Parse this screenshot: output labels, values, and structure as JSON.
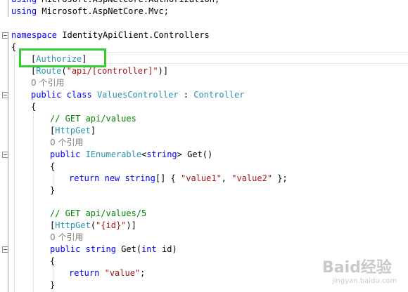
{
  "code": {
    "using_lines": [
      [
        {
          "c": "kw",
          "t": "using"
        },
        {
          "c": "",
          "t": " Microsoft.AspNetCore.Authorization;"
        }
      ],
      [
        {
          "c": "kw",
          "t": "using"
        },
        {
          "c": "",
          "t": " Microsoft.AspNetCore.Mvc;"
        }
      ]
    ],
    "lines": [
      [
        {
          "c": "kw",
          "t": "namespace"
        },
        {
          "c": "",
          "t": " IdentityApiClient.Controllers"
        }
      ],
      [
        {
          "c": "",
          "t": "{"
        }
      ],
      [
        {
          "c": "",
          "t": "["
        },
        {
          "c": "ty",
          "t": "Authorize"
        },
        {
          "c": "",
          "t": "]"
        }
      ],
      [
        {
          "c": "",
          "t": "["
        },
        {
          "c": "ty",
          "t": "Route"
        },
        {
          "c": "",
          "t": "("
        },
        {
          "c": "st",
          "t": "\"api/[controller]\""
        },
        {
          "c": "",
          "t": ")]"
        }
      ],
      [
        {
          "c": "ref",
          "t": "0 个引用"
        }
      ],
      [
        {
          "c": "kw",
          "t": "public"
        },
        {
          "c": "",
          "t": " "
        },
        {
          "c": "kw",
          "t": "class"
        },
        {
          "c": "",
          "t": " "
        },
        {
          "c": "ty",
          "t": "ValuesController"
        },
        {
          "c": "",
          "t": " : "
        },
        {
          "c": "ty",
          "t": "Controller"
        }
      ],
      [
        {
          "c": "",
          "t": "{"
        }
      ],
      [
        {
          "c": "cm",
          "t": "// GET api/values"
        }
      ],
      [
        {
          "c": "",
          "t": "["
        },
        {
          "c": "ty",
          "t": "HttpGet"
        },
        {
          "c": "",
          "t": "]"
        }
      ],
      [
        {
          "c": "ref",
          "t": "0 个引用"
        }
      ],
      [
        {
          "c": "kw",
          "t": "public"
        },
        {
          "c": "",
          "t": " "
        },
        {
          "c": "ty",
          "t": "IEnumerable"
        },
        {
          "c": "",
          "t": "<"
        },
        {
          "c": "kw",
          "t": "string"
        },
        {
          "c": "",
          "t": "> Get()"
        }
      ],
      [
        {
          "c": "",
          "t": "{"
        }
      ],
      [
        {
          "c": "kw",
          "t": "return"
        },
        {
          "c": "",
          "t": " "
        },
        {
          "c": "kw",
          "t": "new"
        },
        {
          "c": "",
          "t": " "
        },
        {
          "c": "kw",
          "t": "string"
        },
        {
          "c": "",
          "t": "[] { "
        },
        {
          "c": "st",
          "t": "\"value1\""
        },
        {
          "c": "",
          "t": ", "
        },
        {
          "c": "st",
          "t": "\"value2\""
        },
        {
          "c": "",
          "t": " };"
        }
      ],
      [
        {
          "c": "",
          "t": "}"
        }
      ],
      [
        {
          "c": "",
          "t": ""
        }
      ],
      [
        {
          "c": "cm",
          "t": "// GET api/values/5"
        }
      ],
      [
        {
          "c": "",
          "t": "["
        },
        {
          "c": "ty",
          "t": "HttpGet"
        },
        {
          "c": "",
          "t": "("
        },
        {
          "c": "st",
          "t": "\"{id}\""
        },
        {
          "c": "",
          "t": ")]"
        }
      ],
      [
        {
          "c": "ref",
          "t": "0 个引用"
        }
      ],
      [
        {
          "c": "kw",
          "t": "public"
        },
        {
          "c": "",
          "t": " "
        },
        {
          "c": "kw",
          "t": "string"
        },
        {
          "c": "",
          "t": " Get("
        },
        {
          "c": "kw",
          "t": "int"
        },
        {
          "c": "",
          "t": " id)"
        }
      ],
      [
        {
          "c": "",
          "t": "{"
        }
      ],
      [
        {
          "c": "kw",
          "t": "return"
        },
        {
          "c": "",
          "t": " "
        },
        {
          "c": "st",
          "t": "\"value\""
        },
        {
          "c": "",
          "t": ";"
        }
      ],
      [
        {
          "c": "",
          "t": "}"
        }
      ]
    ]
  },
  "watermark": {
    "logo": "Baid经验",
    "url": "jingyan.baidu.com"
  },
  "colors": {
    "highlight_border": "#33cc33",
    "keyword": "#0000ff",
    "type": "#2b91af",
    "string": "#a31515",
    "comment": "#008000",
    "codelens": "#808080"
  }
}
